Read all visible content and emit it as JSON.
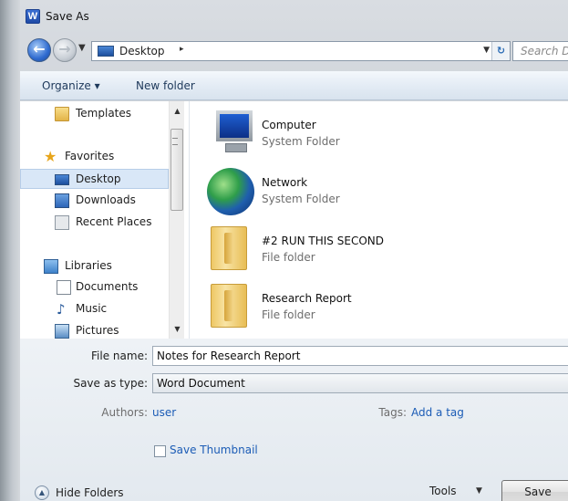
{
  "window": {
    "title": "Save As",
    "app_icon_letter": "W"
  },
  "address_bar": {
    "location": "Desktop",
    "separator": "▸",
    "search_placeholder": "Search Des"
  },
  "toolbar": {
    "organize_label": "Organize ▾",
    "new_folder_label": "New folder"
  },
  "nav_pane": {
    "items": [
      {
        "label": "Templates",
        "icon": "folder-icon"
      },
      {
        "label": "Favorites",
        "icon": "star-icon"
      },
      {
        "label": "Desktop",
        "icon": "desktop-icon",
        "selected": true
      },
      {
        "label": "Downloads",
        "icon": "downloads-icon"
      },
      {
        "label": "Recent Places",
        "icon": "recent-places-icon"
      },
      {
        "label": "Libraries",
        "icon": "libraries-icon"
      },
      {
        "label": "Documents",
        "icon": "document-icon"
      },
      {
        "label": "Music",
        "icon": "music-icon"
      },
      {
        "label": "Pictures",
        "icon": "pictures-icon"
      }
    ]
  },
  "files": [
    {
      "name": "Computer",
      "type": "System Folder",
      "icon": "computer-icon"
    },
    {
      "name": "Network",
      "type": "System Folder",
      "icon": "network-icon"
    },
    {
      "name": "#2 RUN THIS SECOND",
      "type": "File folder",
      "icon": "folder-icon"
    },
    {
      "name": "Research Report",
      "type": "File folder",
      "icon": "folder-icon"
    }
  ],
  "form": {
    "file_name_label": "File name:",
    "file_name_value": "Notes for Research Report",
    "save_type_label": "Save as type:",
    "save_type_value": "Word Document",
    "authors_label": "Authors:",
    "authors_value": "user",
    "tags_label": "Tags:",
    "tags_value": "Add a tag",
    "thumbnail_label": "Save Thumbnail",
    "thumbnail_checked": false
  },
  "footer": {
    "hide_folders_label": "Hide Folders",
    "tools_label": "Tools",
    "save_label": "Save"
  },
  "colors": {
    "link": "#1b5cb6",
    "selection": "#d9e7f7"
  }
}
